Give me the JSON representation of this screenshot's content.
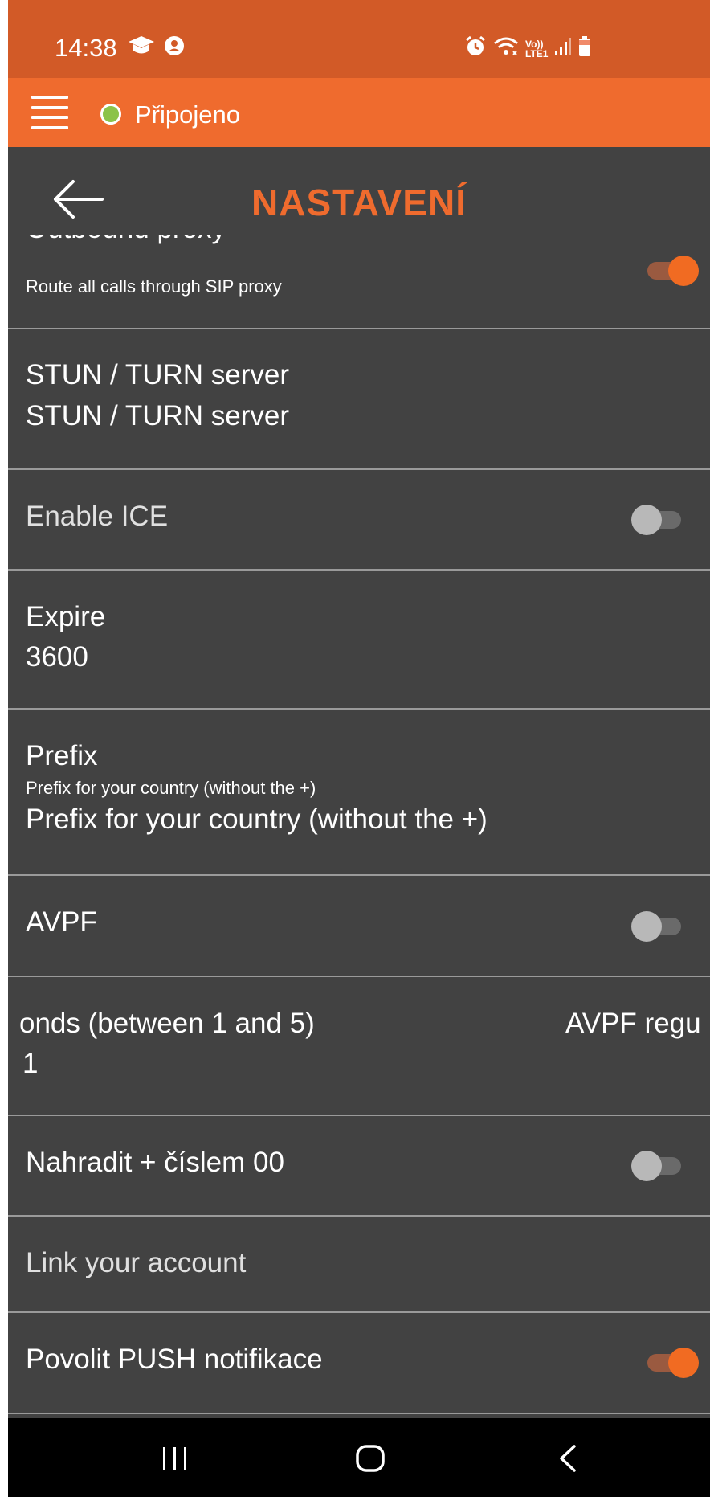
{
  "status_bar": {
    "time": "14:38",
    "icons": [
      "graduation-cap-icon",
      "user-circle-icon",
      "alarm-icon",
      "wifi-icon",
      "volte-lte-icon",
      "signal-icon",
      "battery-icon"
    ],
    "volte_text": "Vo))",
    "lte_text": "LTE1"
  },
  "connection": {
    "label": "Připojeno",
    "dot_color": "#8bc34a"
  },
  "header": {
    "title": "NASTAVENÍ"
  },
  "settings": [
    {
      "title": "Outbound proxy",
      "subtitle": "Route all calls through SIP proxy",
      "toggle": true
    },
    {
      "title": "STUN / TURN server",
      "value": "STUN / TURN server"
    },
    {
      "title": "Enable ICE",
      "toggle": false
    },
    {
      "title": "Expire",
      "value": "3600"
    },
    {
      "title": "Prefix",
      "subtitle": "Prefix for your country (without the +)",
      "value": "Prefix for your country (without the +)"
    },
    {
      "title": "AVPF",
      "toggle": false
    },
    {
      "title_left": "onds (between 1 and 5)",
      "title_right": "AVPF regu",
      "value": "1"
    },
    {
      "title": "Nahradit + číslem 00",
      "toggle": false
    },
    {
      "title": "Link your account"
    },
    {
      "title": "Povolit PUSH notifikace",
      "toggle": true
    }
  ],
  "colors": {
    "status_bar": "#d25a27",
    "accent": "#ef6b2e",
    "background": "#424242",
    "toggle_on": "#f16b22"
  },
  "nav_bar": {
    "icons": [
      "recent-apps-icon",
      "home-icon",
      "back-nav-icon"
    ]
  }
}
